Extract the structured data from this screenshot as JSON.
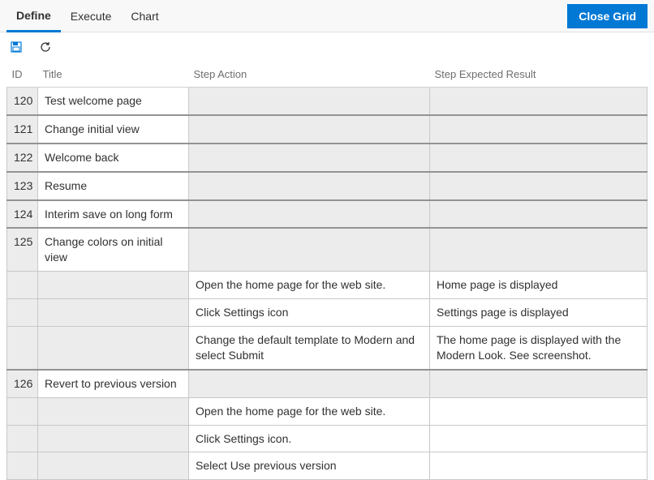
{
  "tabs": {
    "define": "Define",
    "execute": "Execute",
    "chart": "Chart"
  },
  "close_button": "Close Grid",
  "columns": {
    "id": "ID",
    "title": "Title",
    "action": "Step Action",
    "result": "Step Expected Result"
  },
  "rows": [
    {
      "type": "parent",
      "id": "120",
      "title": "Test welcome page"
    },
    {
      "type": "parent",
      "id": "121",
      "title": "Change initial view"
    },
    {
      "type": "parent",
      "id": "122",
      "title": "Welcome back"
    },
    {
      "type": "parent",
      "id": "123",
      "title": "Resume"
    },
    {
      "type": "parent",
      "id": "124",
      "title": "Interim save on long form"
    },
    {
      "type": "parent",
      "id": "125",
      "title": "Change colors on initial view"
    },
    {
      "type": "step",
      "action": "Open the home page for the web site.",
      "result": "Home page is displayed"
    },
    {
      "type": "step",
      "action": "Click Settings icon",
      "result": "Settings page is displayed"
    },
    {
      "type": "step",
      "action": "Change the default template to Modern and select Submit",
      "result": "The home page is displayed with the Modern Look. See screenshot."
    },
    {
      "type": "parent",
      "id": "126",
      "title": "Revert to previous version"
    },
    {
      "type": "step",
      "action": "Open the home page for the web site.",
      "result": ""
    },
    {
      "type": "step",
      "action": "Click Settings icon.",
      "result": ""
    },
    {
      "type": "step",
      "action": "Select Use previous version",
      "result": ""
    }
  ]
}
